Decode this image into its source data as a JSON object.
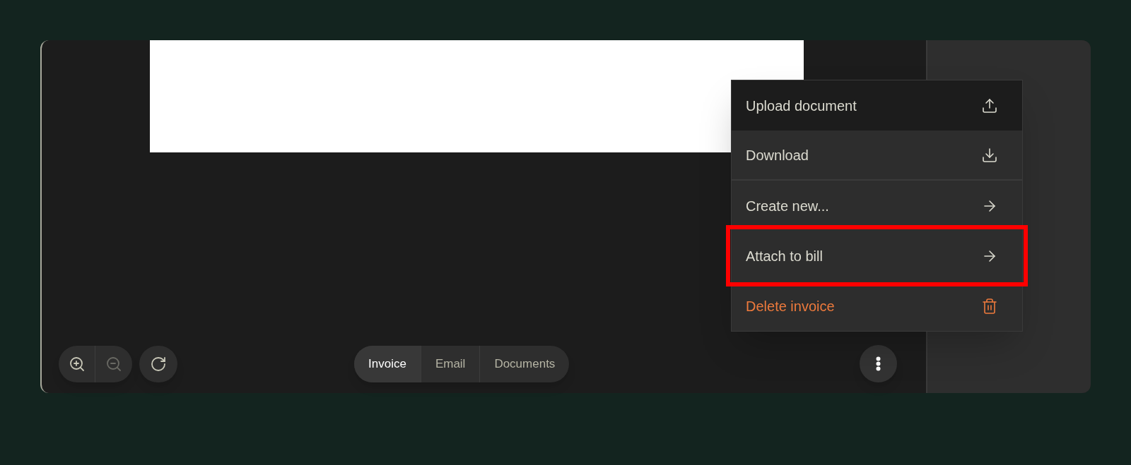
{
  "zoom_controls": {
    "zoom_in": {
      "disabled": false
    },
    "zoom_out": {
      "disabled": true
    }
  },
  "view_tabs": [
    {
      "label": "Invoice",
      "selected": true
    },
    {
      "label": "Email",
      "selected": false
    },
    {
      "label": "Documents",
      "selected": false
    }
  ],
  "menu": {
    "items": [
      {
        "label": "Upload document",
        "kind": "upload",
        "highlighted": true,
        "divider_after": false
      },
      {
        "label": "Download",
        "kind": "download",
        "highlighted": false,
        "divider_after": true
      },
      {
        "label": "Create new...",
        "kind": "submenu",
        "highlighted": false,
        "divider_after": false
      },
      {
        "label": "Attach to bill",
        "kind": "submenu",
        "highlighted": false,
        "divider_after": false,
        "annotated": true
      },
      {
        "label": "Delete invoice",
        "kind": "danger",
        "highlighted": false,
        "divider_after": false
      }
    ]
  }
}
